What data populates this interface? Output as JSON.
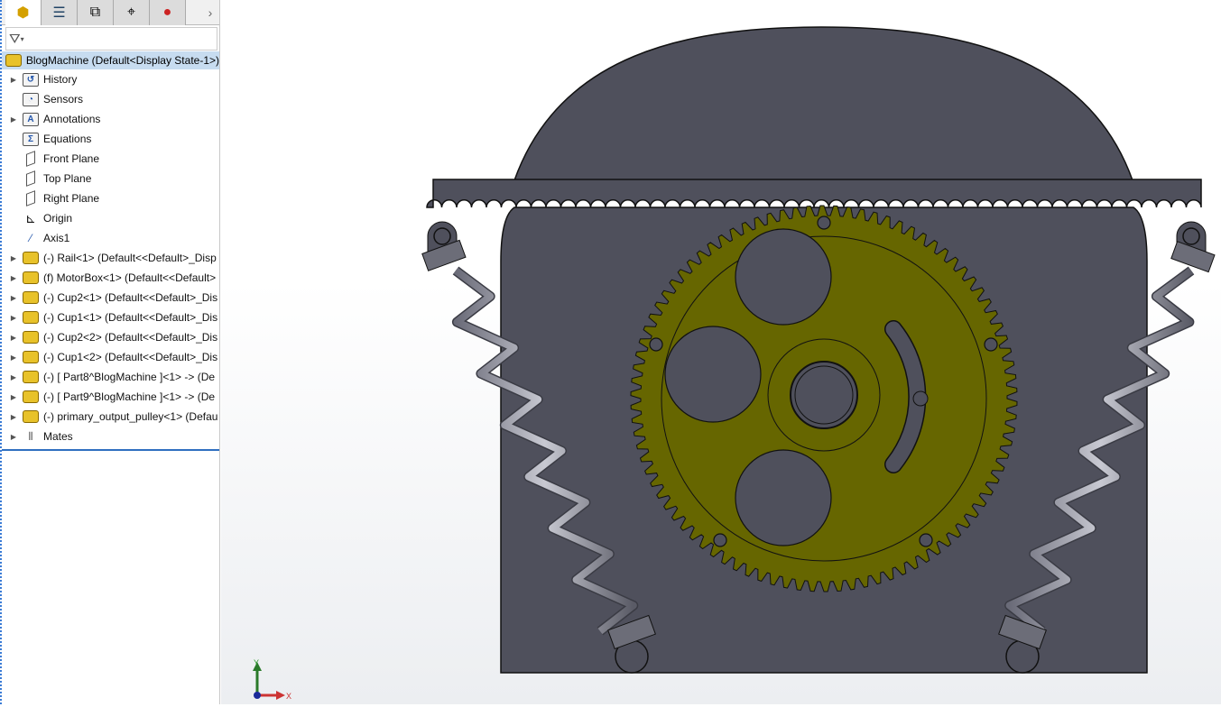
{
  "tree": {
    "root": "BlogMachine  (Default<Display State-1>)",
    "items": [
      {
        "label": "History",
        "icon": "history-folder-icon",
        "expand": true
      },
      {
        "label": "Sensors",
        "icon": "sensors-folder-icon",
        "expand": false
      },
      {
        "label": "Annotations",
        "icon": "annotations-folder-icon",
        "expand": true
      },
      {
        "label": "Equations",
        "icon": "equations-folder-icon",
        "expand": false
      },
      {
        "label": "Front Plane",
        "icon": "plane-icon",
        "expand": false
      },
      {
        "label": "Top Plane",
        "icon": "plane-icon",
        "expand": false
      },
      {
        "label": "Right Plane",
        "icon": "plane-icon",
        "expand": false
      },
      {
        "label": "Origin",
        "icon": "origin-icon",
        "expand": false
      },
      {
        "label": "Axis1",
        "icon": "axis-icon",
        "expand": false
      },
      {
        "label": "(-) Rail<1> (Default<<Default>_Disp",
        "icon": "part-icon",
        "expand": true
      },
      {
        "label": "(f) MotorBox<1> (Default<<Default>",
        "icon": "part-icon",
        "expand": true
      },
      {
        "label": "(-) Cup2<1> (Default<<Default>_Dis",
        "icon": "part-icon",
        "expand": true
      },
      {
        "label": "(-) Cup1<1> (Default<<Default>_Dis",
        "icon": "part-icon",
        "expand": true
      },
      {
        "label": "(-) Cup2<2> (Default<<Default>_Dis",
        "icon": "part-icon",
        "expand": true
      },
      {
        "label": "(-) Cup1<2> (Default<<Default>_Dis",
        "icon": "part-icon",
        "expand": true
      },
      {
        "label": "(-) [ Part8^BlogMachine ]<1> -> (De",
        "icon": "part-icon",
        "expand": true
      },
      {
        "label": "(-) [ Part9^BlogMachine ]<1> -> (De",
        "icon": "part-icon",
        "expand": true
      },
      {
        "label": "(-) primary_output_pulley<1> (Defau",
        "icon": "part-icon",
        "expand": true
      },
      {
        "label": "Mates",
        "icon": "mates-icon",
        "expand": true
      }
    ]
  },
  "triad": {
    "x": "X",
    "y": "Y"
  },
  "colors": {
    "gear": "#666600",
    "body": "#4f505c",
    "selection": "#c7dcf0"
  }
}
